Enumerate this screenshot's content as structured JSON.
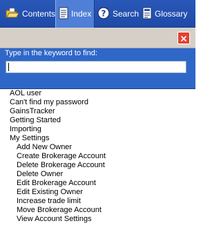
{
  "tabs": [
    {
      "label": "Contents",
      "icon": "folder-open-icon"
    },
    {
      "label": "Index",
      "icon": "index-book-icon",
      "active": true
    },
    {
      "label": "Search",
      "icon": "search-help-icon"
    },
    {
      "label": "Glossary",
      "icon": "glossary-book-icon"
    }
  ],
  "panel": {
    "label": "Type in the keyword to find:",
    "keyword_value": "",
    "keyword_placeholder": ""
  },
  "index_items": [
    {
      "label": "AOL user",
      "level": 0
    },
    {
      "label": "Can't find my password",
      "level": 0
    },
    {
      "label": "GainsTracker",
      "level": 0
    },
    {
      "label": "Getting Started",
      "level": 0
    },
    {
      "label": "Importing",
      "level": 0
    },
    {
      "label": "My Settings",
      "level": 0
    },
    {
      "label": "Add New Owner",
      "level": 1
    },
    {
      "label": "Create Brokerage Account",
      "level": 1
    },
    {
      "label": "Delete Brokerage Account",
      "level": 1
    },
    {
      "label": "Delete Owner",
      "level": 1
    },
    {
      "label": "Edit Brokerage Account",
      "level": 1
    },
    {
      "label": "Edit Existing Owner",
      "level": 1
    },
    {
      "label": "Increase trade limit",
      "level": 1
    },
    {
      "label": "Move Brokerage Account",
      "level": 1
    },
    {
      "label": "View Account Settings",
      "level": 1
    }
  ],
  "colors": {
    "tabbar": "#1e4aa8",
    "panel": "#2f67c9",
    "close_button": "#e2422f"
  }
}
